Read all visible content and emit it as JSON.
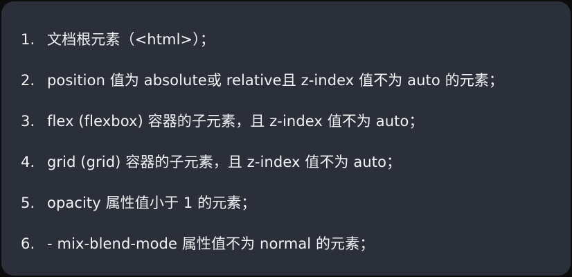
{
  "list": {
    "items": [
      {
        "number": "1.",
        "text": "文档根元素（<html>）；"
      },
      {
        "number": "2.",
        "text": "position 值为 absolute或  relative且 z-index 值不为 auto 的元素；"
      },
      {
        "number": "3.",
        "text": " flex (flexbox) 容器的子元素，且 z-index 值不为 auto；"
      },
      {
        "number": "4.",
        "text": " grid (grid) 容器的子元素，且 z-index 值不为 auto；"
      },
      {
        "number": "5.",
        "text": "opacity 属性值小于 1 的元素；"
      },
      {
        "number": "6.",
        "text": "- mix-blend-mode 属性值不为 normal 的元素；"
      }
    ]
  },
  "colors": {
    "background": "#2a2f3a",
    "text": "#f2f3f5"
  }
}
